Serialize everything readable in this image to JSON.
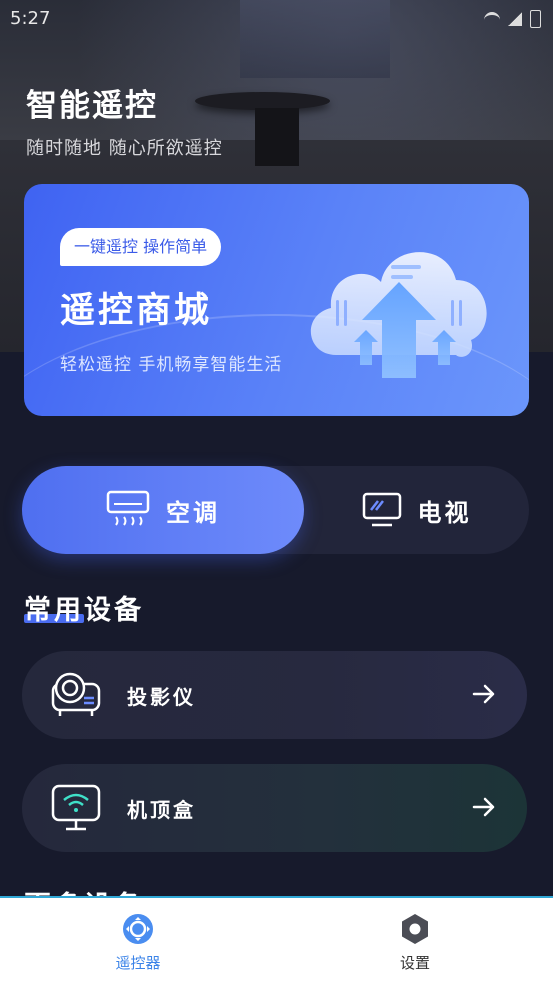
{
  "status_bar": {
    "time": "5:27"
  },
  "hero": {
    "title": "智能遥控",
    "subtitle": "随时随地 随心所欲遥控"
  },
  "banner": {
    "tag": "一键遥控 操作简单",
    "title": "遥控商城",
    "description": "轻松遥控 手机畅享智能生活"
  },
  "switcher": {
    "tabs": [
      {
        "label": "空调",
        "icon": "air-conditioner-icon",
        "active": true
      },
      {
        "label": "电视",
        "icon": "tv-icon",
        "active": false
      }
    ]
  },
  "common_devices": {
    "title": "常用设备",
    "items": [
      {
        "label": "投影仪",
        "icon": "projector-icon"
      },
      {
        "label": "机顶盒",
        "icon": "set-top-box-icon"
      }
    ]
  },
  "more_devices": {
    "title": "更多设备"
  },
  "tabbar": {
    "items": [
      {
        "label": "遥控器",
        "icon": "remote-icon",
        "active": true
      },
      {
        "label": "设置",
        "icon": "settings-hexagon-icon",
        "active": false
      }
    ]
  },
  "colors": {
    "accent": "#4f6ff0",
    "tab_active": "#3c84e8",
    "background": "#171a2c"
  }
}
